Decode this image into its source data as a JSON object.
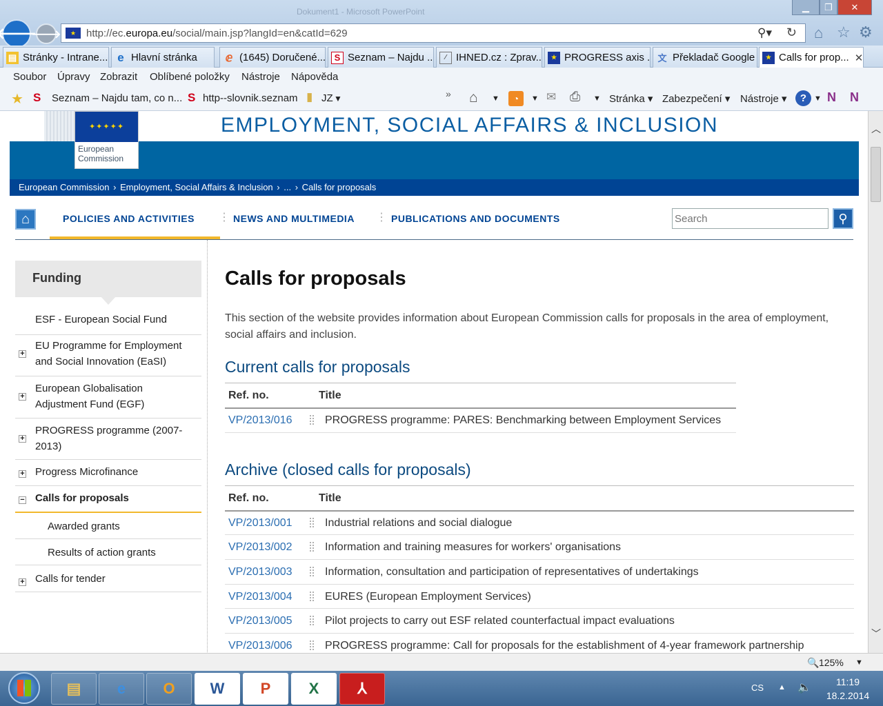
{
  "browser": {
    "address_url": "http://ec.europa.eu/social/main.jsp?langId=en&catId=629",
    "url_prefix": "http://ec.",
    "url_domain": "europa.eu",
    "url_suffix": "/social/main.jsp?langId=en&catId=629",
    "window_title_ghost": "Dokument1 - Microsoft PowerPoint",
    "tabs": [
      {
        "label": "Stránky - Intrane...",
        "icon": "folder-icon"
      },
      {
        "label": "Hlavní stránka",
        "icon": "ie-icon"
      },
      {
        "label": "(1645) Doručené...",
        "icon": "mail-icon"
      },
      {
        "label": "Seznam – Najdu ...",
        "icon": "seznam-icon"
      },
      {
        "label": "IHNED.cz : Zprav...",
        "icon": "news-icon"
      },
      {
        "label": "PROGRESS axis ...",
        "icon": "eu-flag-icon"
      },
      {
        "label": "Překladač Google",
        "icon": "translate-icon"
      },
      {
        "label": "Calls for prop...",
        "icon": "eu-flag-icon"
      }
    ],
    "menu": [
      "Soubor",
      "Úpravy",
      "Zobrazit",
      "Oblíbené položky",
      "Nástroje",
      "Nápověda"
    ],
    "favorites": [
      "Seznam – Najdu tam, co n...",
      "http--slovnik.seznam",
      "JZ"
    ],
    "command_bar": [
      "Stránka",
      "Zabezpečení",
      "Nástroje"
    ],
    "zoom": "125%"
  },
  "site": {
    "brand_line1": "European",
    "brand_line2": "Commission",
    "section_title": "EMPLOYMENT, SOCIAL AFFAIRS & INCLUSION",
    "breadcrumb": [
      "European Commission",
      "Employment, Social Affairs & Inclusion",
      "...",
      "Calls for proposals"
    ],
    "nav": [
      "POLICIES AND ACTIVITIES",
      "NEWS AND MULTIMEDIA",
      "PUBLICATIONS AND DOCUMENTS"
    ],
    "search_placeholder": "Search"
  },
  "sidebar": {
    "heading": "Funding",
    "items": [
      {
        "label": "ESF - European Social Fund"
      },
      {
        "label": "EU Programme for Employment and Social Innovation (EaSI)"
      },
      {
        "label": "European Globalisation Adjustment Fund (EGF)"
      },
      {
        "label": "PROGRESS programme (2007-2013)"
      },
      {
        "label": "Progress Microfinance"
      },
      {
        "label": "Calls for proposals"
      },
      {
        "label": "Awarded grants"
      },
      {
        "label": "Results of action grants"
      },
      {
        "label": "Calls for tender"
      }
    ]
  },
  "main": {
    "title": "Calls for proposals",
    "intro": "This section of the website provides information about European Commission calls for proposals in the area of employment, social affairs and inclusion.",
    "current_heading": "Current calls for proposals",
    "archive_heading": "Archive (closed calls for proposals)",
    "col_ref": "Ref. no.",
    "col_title": "Title",
    "current": [
      {
        "ref": "VP/2013/016",
        "title": "PROGRESS programme: PARES: Benchmarking between Employment Services"
      }
    ],
    "archive": [
      {
        "ref": "VP/2013/001",
        "title": "Industrial relations and social dialogue"
      },
      {
        "ref": "VP/2013/002",
        "title": "Information and training measures for workers' organisations"
      },
      {
        "ref": "VP/2013/003",
        "title": "Information, consultation and participation of representatives of undertakings"
      },
      {
        "ref": "VP/2013/004",
        "title": "EURES (European Employment Services)"
      },
      {
        "ref": "VP/2013/005",
        "title": "Pilot projects to carry out ESF related counterfactual impact evaluations"
      },
      {
        "ref": "VP/2013/006",
        "title": "PROGRESS programme: Call for proposals for the establishment of 4-year framework partnership"
      }
    ]
  },
  "taskbar": {
    "lang": "CS",
    "time": "11:19",
    "date": "18.2.2014"
  }
}
